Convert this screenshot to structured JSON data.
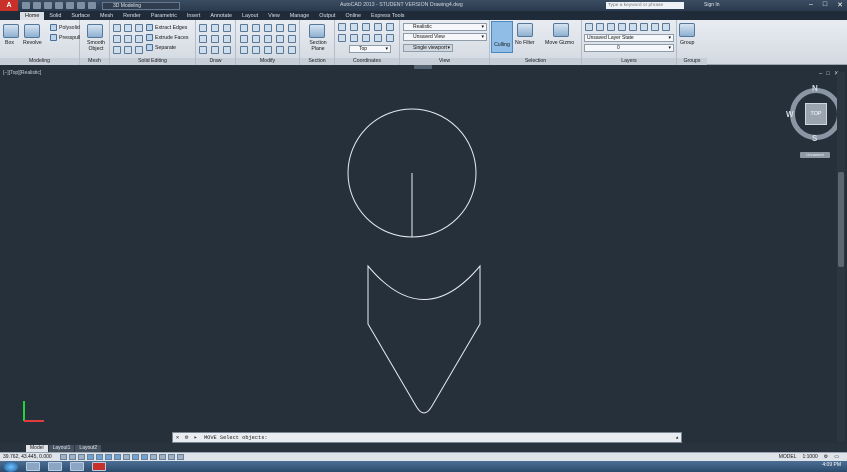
{
  "titlebar": {
    "logo": "A",
    "workspace": "3D Modeling",
    "title": "AutoCAD 2013 - STUDENT VERSION   Drawing4.dwg",
    "search_placeholder": "Type a keyword or phrase",
    "signin": "Sign In",
    "min": "–",
    "max": "□",
    "close": "✕"
  },
  "tabs": [
    "Home",
    "Solid",
    "Surface",
    "Mesh",
    "Render",
    "Parametric",
    "Insert",
    "Annotate",
    "Layout",
    "View",
    "Manage",
    "Output",
    "Online",
    "Express Tools"
  ],
  "ribbon": {
    "modeling": {
      "title": "Modeling",
      "box": "Box",
      "revolve": "Revolve",
      "polysolid": "Polysolid",
      "presspull": "Presspull"
    },
    "mesh": {
      "title": "Mesh",
      "smooth": "Smooth Object"
    },
    "solid_editing": {
      "title": "Solid Editing",
      "extract": "Extract Edges",
      "extrude": "Extrude Faces",
      "separate": "Separate"
    },
    "draw": {
      "title": "Draw"
    },
    "modify": {
      "title": "Modify"
    },
    "section": {
      "title": "Section",
      "plane": "Section Plane"
    },
    "coordinates": {
      "title": "Coordinates",
      "top": "Top"
    },
    "view": {
      "title": "View",
      "visual_style": "Realistic",
      "named_view": "Unsaved View",
      "viewport": "Single viewport"
    },
    "selection": {
      "title": "Selection",
      "culling": "Culling",
      "no_filter": "No Filter",
      "gizmo": "Move Gizmo"
    },
    "layers": {
      "title": "Layers",
      "layer_state": "Unsaved Layer State",
      "layer": "0"
    },
    "groups": {
      "title": "Groups",
      "group": "Group"
    }
  },
  "viewport": {
    "label": "[−][Top][Realistic]",
    "viewcube": {
      "face": "TOP",
      "n": "N",
      "e": "E",
      "s": "S",
      "w": "W",
      "ucs": "Unnamed"
    }
  },
  "command": {
    "prompt": "MOVE Select objects:"
  },
  "layout_tabs": [
    "Model",
    "Layout1",
    "Layout2"
  ],
  "status": {
    "coords": "39.762, 43.445, 0.000",
    "model": "MODEL",
    "scale": "1:1000"
  },
  "taskbar": {
    "time": "4:09 PM"
  }
}
